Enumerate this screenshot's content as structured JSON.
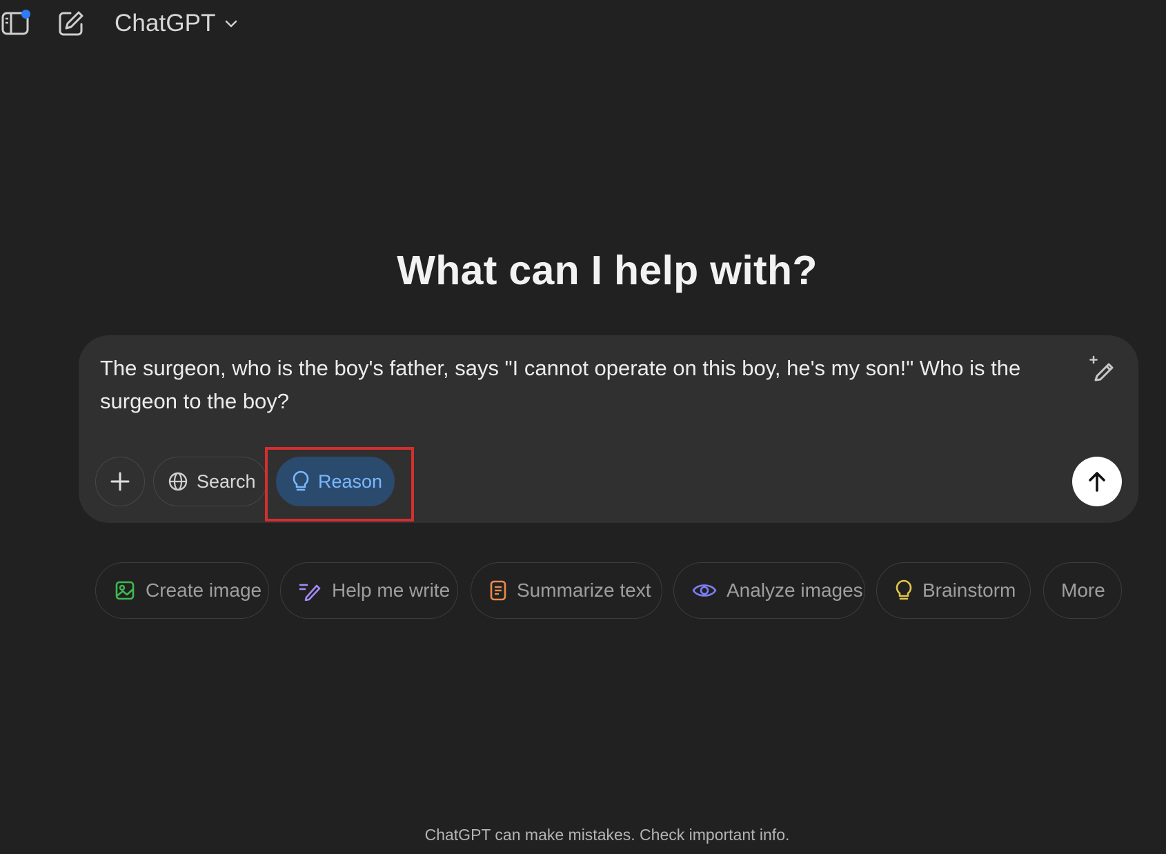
{
  "header": {
    "model_name": "ChatGPT",
    "sidebar_toggle_icon": "sidebar-toggle-icon",
    "new_chat_icon": "new-chat-icon",
    "notification_color": "#2f7cf6"
  },
  "main": {
    "heading": "What can I help with?"
  },
  "composer": {
    "prompt": "The surgeon, who is the boy's father, says \"I cannot operate on this boy, he's my son!\" Who is the surgeon to the boy?",
    "search_label": "Search",
    "reason_label": "Reason",
    "reason_active": true,
    "reason_color": "#7ab8ff",
    "highlight_color": "#d32f2f"
  },
  "suggestions": [
    {
      "label": "Create image",
      "icon": "create-image-icon",
      "color": "#3fb950"
    },
    {
      "label": "Help me write",
      "icon": "pen-icon",
      "color": "#a58bf6"
    },
    {
      "label": "Summarize text",
      "icon": "document-icon",
      "color": "#e88b4e"
    },
    {
      "label": "Analyze images",
      "icon": "eye-icon",
      "color": "#7c7ff5"
    },
    {
      "label": "Brainstorm",
      "icon": "lightbulb-icon",
      "color": "#e2c54b"
    },
    {
      "label": "More",
      "icon": "",
      "color": ""
    }
  ],
  "footer": {
    "disclaimer": "ChatGPT can make mistakes. Check important info."
  }
}
